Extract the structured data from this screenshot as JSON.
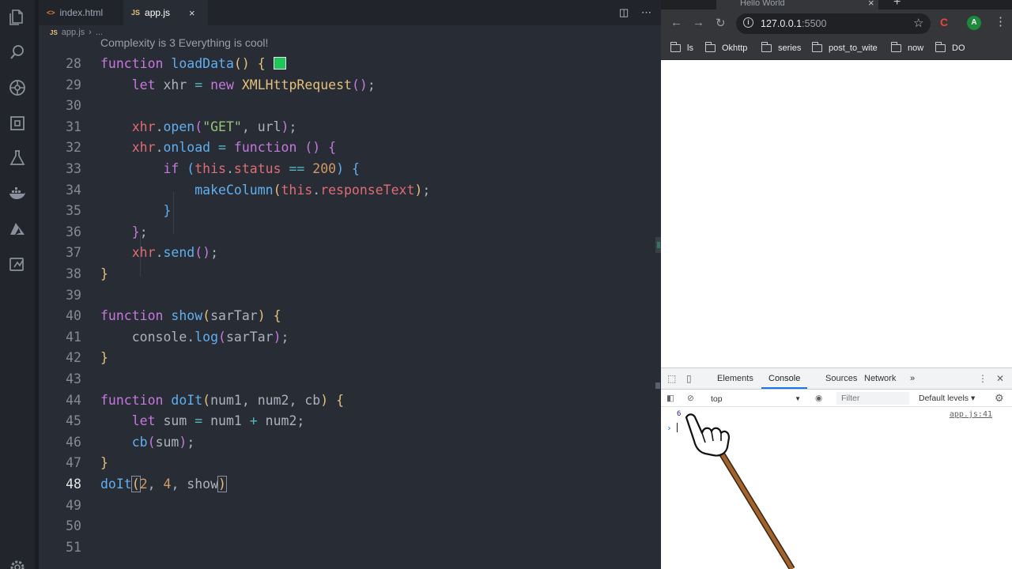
{
  "editor": {
    "tabs": [
      {
        "icon": "<>",
        "label": "index.html"
      },
      {
        "icon": "JS",
        "label": "app.js",
        "close": "×"
      }
    ],
    "breadcrumb": {
      "icon": "JS",
      "file": "app.js",
      "sep": "›",
      "more": "..."
    },
    "codelens": "Complexity is 3 Everything is cool!",
    "current_line": "48",
    "lines": [
      {
        "n": "28"
      },
      {
        "n": "29"
      },
      {
        "n": "30"
      },
      {
        "n": "31"
      },
      {
        "n": "32"
      },
      {
        "n": "33"
      },
      {
        "n": "34"
      },
      {
        "n": "35"
      },
      {
        "n": "36"
      },
      {
        "n": "37"
      },
      {
        "n": "38"
      },
      {
        "n": "39"
      },
      {
        "n": "40"
      },
      {
        "n": "41"
      },
      {
        "n": "42"
      },
      {
        "n": "43"
      },
      {
        "n": "44"
      },
      {
        "n": "45"
      },
      {
        "n": "46"
      },
      {
        "n": "47"
      },
      {
        "n": "48"
      },
      {
        "n": "49"
      },
      {
        "n": "50"
      },
      {
        "n": "51"
      }
    ],
    "code": {
      "l28": [
        "function",
        "loadData",
        "()",
        "{"
      ],
      "l29": [
        "let",
        "xhr",
        "=",
        "new",
        "XMLHttpRequest",
        "();"
      ],
      "l31": [
        "xhr",
        ".",
        "open",
        "(",
        "\"GET\"",
        ", url);"
      ],
      "l32": [
        "xhr",
        ".",
        "onload",
        "=",
        "function",
        "()",
        "{"
      ],
      "l33": [
        "if",
        "(",
        "this",
        ".",
        "status",
        "==",
        "200",
        ")",
        "{"
      ],
      "l34": [
        "makeColumn",
        "(",
        "this",
        ".",
        "responseText",
        ");"
      ],
      "l35": [
        "}"
      ],
      "l36": [
        "};"
      ],
      "l37": [
        "xhr",
        ".",
        "send",
        "();"
      ],
      "l38": [
        "}"
      ],
      "l40": [
        "function",
        "show",
        "(sarTar)",
        "{"
      ],
      "l41": [
        "console",
        ".",
        "log",
        "(sarTar);"
      ],
      "l42": [
        "}"
      ],
      "l44": [
        "function",
        "doIt",
        "(num1, num2, cb)",
        "{"
      ],
      "l45": [
        "let",
        "sum",
        "=",
        "num1",
        "+",
        "num2;"
      ],
      "l46": [
        "cb",
        "(sum);"
      ],
      "l47": [
        "}"
      ],
      "l48": [
        "doIt",
        "(",
        "2",
        ", ",
        "4",
        ", show",
        ")"
      ]
    },
    "swatch_color": "#1ec65a"
  },
  "browser": {
    "tab_title": "Hello World",
    "tab_close": "×",
    "new_tab": "+",
    "url_host": "127.0.0.1",
    "url_port": ":5500",
    "ext_label": "C",
    "avatar": "A",
    "bookmarks": [
      "ls",
      "Okhttp",
      "series",
      "post_to_wite",
      "now",
      "DO"
    ]
  },
  "devtools": {
    "tabs": [
      "Elements",
      "Console",
      "Sources",
      "Network"
    ],
    "active_tab": "Console",
    "more": "»",
    "context": "top",
    "filter_placeholder": "Filter",
    "levels": "Default levels ▾",
    "log_value": "6",
    "log_source": "app.js:41",
    "prompt": "›"
  }
}
